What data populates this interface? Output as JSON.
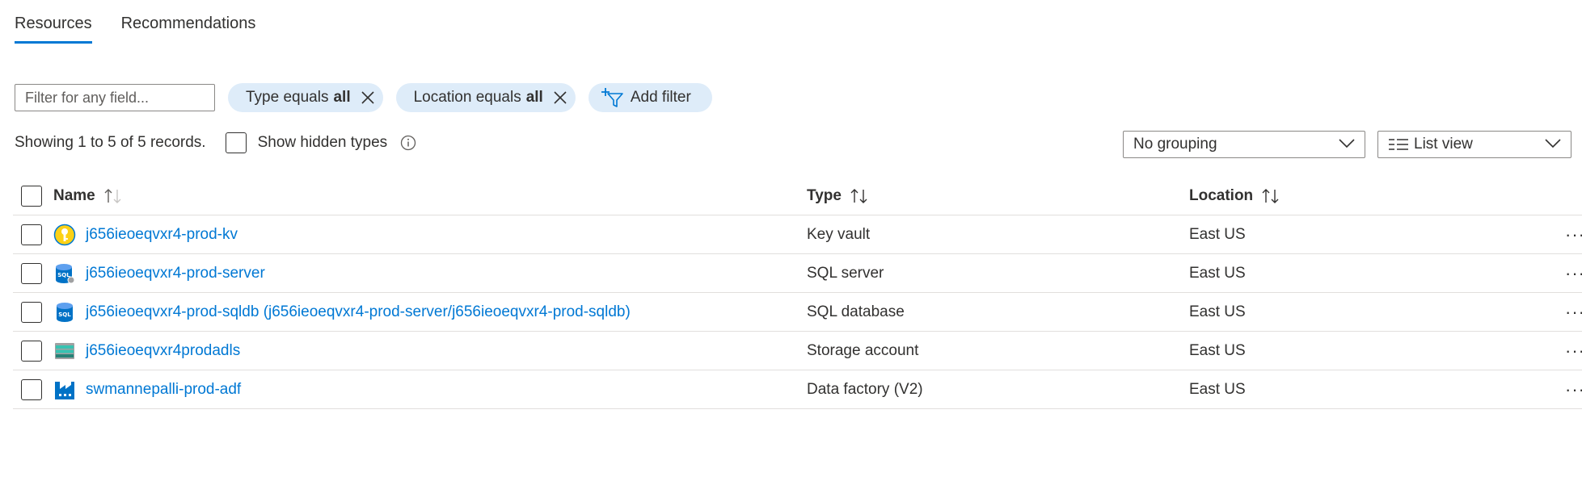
{
  "tabs": [
    {
      "label": "Resources",
      "active": true
    },
    {
      "label": "Recommendations",
      "active": false
    }
  ],
  "filter": {
    "placeholder": "Filter for any field...",
    "pills": [
      {
        "prefix": "Type equals",
        "value": "all"
      },
      {
        "prefix": "Location equals",
        "value": "all"
      }
    ],
    "add_label": "Add filter"
  },
  "records_text": "Showing 1 to 5 of 5 records.",
  "show_hidden_label": "Show hidden types",
  "grouping": {
    "selected": "No grouping"
  },
  "view": {
    "selected": "List view"
  },
  "columns": {
    "name": "Name",
    "type": "Type",
    "location": "Location"
  },
  "rows": [
    {
      "name": "j656ieoeqvxr4-prod-kv",
      "type": "Key vault",
      "location": "East US",
      "icon": "key-vault-icon"
    },
    {
      "name": "j656ieoeqvxr4-prod-server",
      "type": "SQL server",
      "location": "East US",
      "icon": "sql-server-icon"
    },
    {
      "name": "j656ieoeqvxr4-prod-sqldb (j656ieoeqvxr4-prod-server/j656ieoeqvxr4-prod-sqldb)",
      "type": "SQL database",
      "location": "East US",
      "icon": "sql-database-icon"
    },
    {
      "name": "j656ieoeqvxr4prodadls",
      "type": "Storage account",
      "location": "East US",
      "icon": "storage-account-icon"
    },
    {
      "name": "swmannepalli-prod-adf",
      "type": "Data factory (V2)",
      "location": "East US",
      "icon": "data-factory-icon"
    }
  ],
  "colors": {
    "accent": "#0078d4",
    "pill": "#deecf9",
    "text": "#323130"
  }
}
